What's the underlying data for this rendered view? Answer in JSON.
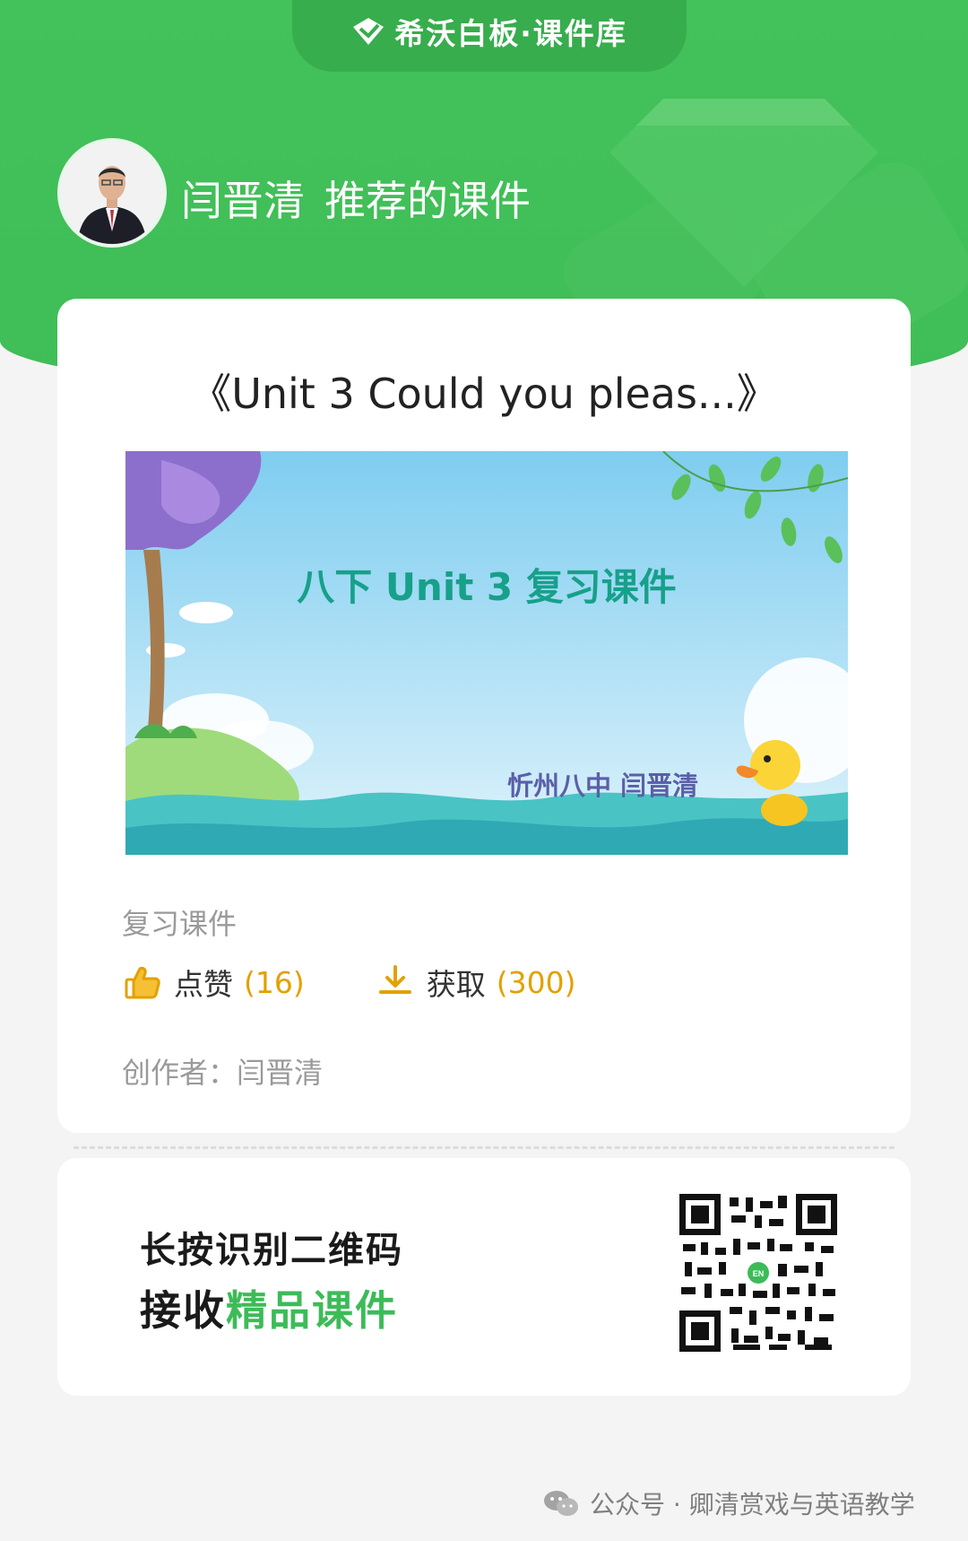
{
  "brand": {
    "title": "希沃白板·课件库"
  },
  "recommender": {
    "name": "闫晋清",
    "suffix": "推荐的课件"
  },
  "course": {
    "title": "《Unit 3 Could you pleas...》",
    "cover_title": "八下 Unit 3 复习课件",
    "cover_author": "忻州八中 闫晋清",
    "category": "复习课件",
    "like_label": "点赞",
    "like_count": "(16)",
    "get_label": "获取",
    "get_count": "(300)",
    "author_line": "创作者：闫晋清"
  },
  "qr": {
    "line1": "长按识别二维码",
    "line2_prefix": "接收",
    "line2_highlight": "精品课件"
  },
  "footer": {
    "text": "公众号 · 卿清赏戏与英语教学"
  },
  "colors": {
    "brand_green": "#3fbd57",
    "accent_yellow": "#e2a100"
  }
}
